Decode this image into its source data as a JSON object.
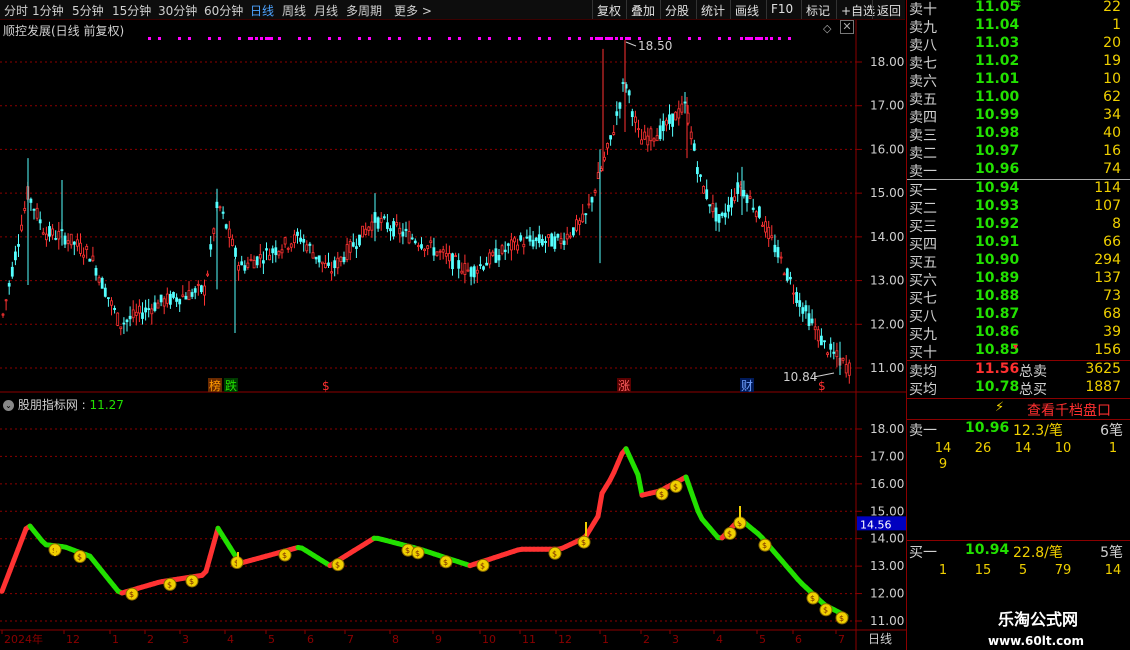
{
  "toolbar": {
    "periods": [
      "分时",
      "1分钟",
      "5分钟",
      "15分钟",
      "30分钟",
      "60分钟",
      "日线",
      "周线",
      "月线",
      "多周期",
      "更多"
    ],
    "active_period": "日线",
    "buttons": [
      "复权",
      "叠加",
      "分股",
      "统计",
      "画线",
      "F10",
      "标记",
      "+自选",
      "返回"
    ]
  },
  "main_panel": {
    "title": "顺控发展(日线 前复权)",
    "high_label": "18.50",
    "low_label": "10.84",
    "y_ticks": [
      "18.00",
      "17.00",
      "16.00",
      "15.00",
      "14.00",
      "13.00",
      "12.00",
      "11.00"
    ],
    "event_markers": [
      {
        "text": "榜",
        "color": "#ff9900",
        "bg": "#6a2a00"
      },
      {
        "text": "跌",
        "color": "#22e000",
        "bg": "#003a00"
      },
      {
        "text": "$",
        "color": "#ff3030",
        "bg": ""
      },
      {
        "text": "涨",
        "color": "#ff6060",
        "bg": "#5a0000"
      },
      {
        "text": "财",
        "color": "#70a0ff",
        "bg": "#001a5a"
      },
      {
        "text": "$",
        "color": "#ff3030",
        "bg": ""
      }
    ]
  },
  "sub_panel": {
    "title": "股朋指标网",
    "value": "11.27",
    "y_ticks": [
      "18.00",
      "17.00",
      "16.00",
      "15.00",
      "14.00",
      "13.00",
      "12.00",
      "11.00"
    ],
    "current_label": "14.56"
  },
  "time_axis": {
    "labels": [
      "2024年",
      "12",
      "1",
      "2",
      "3",
      "4",
      "5",
      "6",
      "7",
      "8",
      "9",
      "10",
      "11",
      "12",
      "1",
      "2",
      "3",
      "4",
      "5",
      "6",
      "7"
    ],
    "period": "日线"
  },
  "orderbook": {
    "asks": [
      {
        "label": "卖十",
        "price": "11.05",
        "vol": "22"
      },
      {
        "label": "卖九",
        "price": "11.04",
        "vol": "1"
      },
      {
        "label": "卖八",
        "price": "11.03",
        "vol": "20"
      },
      {
        "label": "卖七",
        "price": "11.02",
        "vol": "19"
      },
      {
        "label": "卖六",
        "price": "11.01",
        "vol": "10"
      },
      {
        "label": "卖五",
        "price": "11.00",
        "vol": "62"
      },
      {
        "label": "卖四",
        "price": "10.99",
        "vol": "34"
      },
      {
        "label": "卖三",
        "price": "10.98",
        "vol": "40"
      },
      {
        "label": "卖二",
        "price": "10.97",
        "vol": "16"
      },
      {
        "label": "卖一",
        "price": "10.96",
        "vol": "74"
      }
    ],
    "bids": [
      {
        "label": "买一",
        "price": "10.94",
        "vol": "114"
      },
      {
        "label": "买二",
        "price": "10.93",
        "vol": "107"
      },
      {
        "label": "买三",
        "price": "10.92",
        "vol": "8"
      },
      {
        "label": "买四",
        "price": "10.91",
        "vol": "66"
      },
      {
        "label": "买五",
        "price": "10.90",
        "vol": "294"
      },
      {
        "label": "买六",
        "price": "10.89",
        "vol": "137"
      },
      {
        "label": "买七",
        "price": "10.88",
        "vol": "73"
      },
      {
        "label": "买八",
        "price": "10.87",
        "vol": "68"
      },
      {
        "label": "买九",
        "price": "10.86",
        "vol": "39"
      },
      {
        "label": "买十",
        "price": "10.85",
        "vol": "156"
      }
    ],
    "avg_ask": {
      "label": "卖均",
      "price": "11.56",
      "total_label": "总卖",
      "total": "3625"
    },
    "avg_bid": {
      "label": "买均",
      "price": "10.78",
      "total_label": "总买",
      "total": "1887"
    },
    "view_button": "查看千档盘口",
    "sell_queue": {
      "label": "卖一",
      "price": "10.96",
      "amount": "12.3/笔",
      "count": "6笔",
      "row1": [
        "14",
        "26",
        "14",
        "10",
        "1"
      ],
      "row2": [
        "9"
      ]
    },
    "buy_queue": {
      "label": "买一",
      "price": "10.94",
      "amount": "22.8/笔",
      "count": "5笔",
      "row1": [
        "1",
        "15",
        "5",
        "79",
        "14"
      ]
    }
  },
  "watermark": {
    "line1": "乐淘公式网",
    "line2": "www.60lt.com"
  },
  "colors": {
    "up": "#ff3232",
    "down": "#54ffff",
    "green": "#22e000",
    "yellow": "#f0d000",
    "magenta": "#ff00ff",
    "grid": "#8b0000",
    "blue": "#0000c0"
  }
}
